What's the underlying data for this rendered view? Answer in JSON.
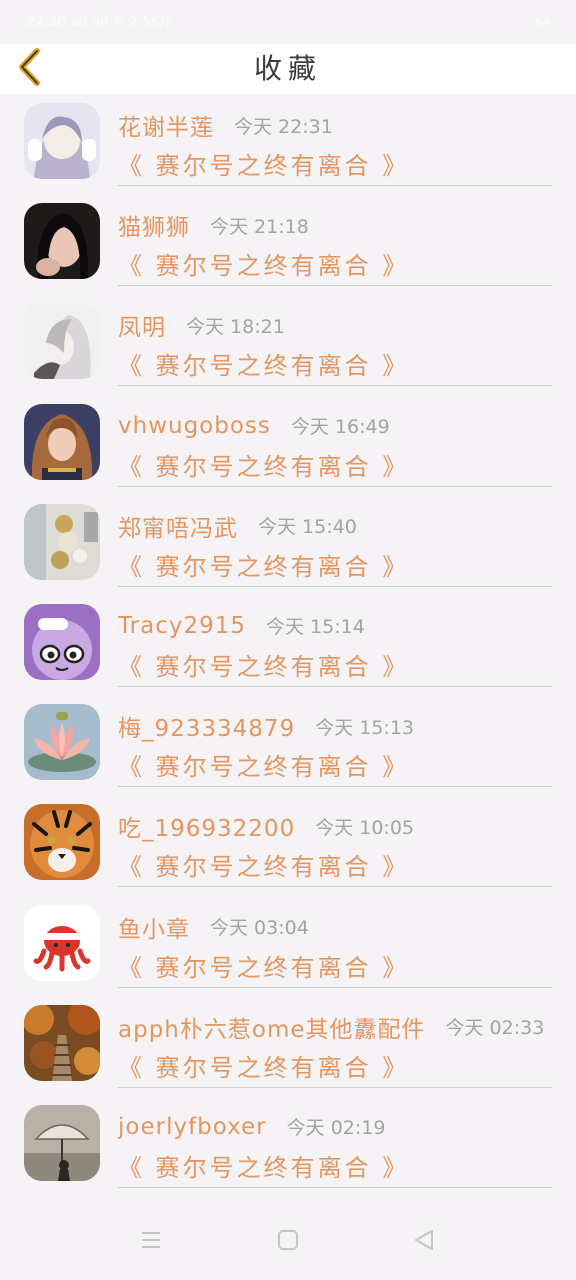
{
  "status_bar": {
    "time_info": "22:30 ail ail ≋ 2.5K/s",
    "battery": "64"
  },
  "header": {
    "title": "收藏",
    "back_icon": "chevron-left-icon",
    "accent_color": "#e0a11c"
  },
  "items": [
    {
      "name": "花谢半莲",
      "time": "今天 22:31",
      "work": "《 赛尔号之终有离合 》"
    },
    {
      "name": "猫狮狮",
      "time": "今天 21:18",
      "work": "《 赛尔号之终有离合 》"
    },
    {
      "name": "凤明",
      "time": "今天 18:21",
      "work": "《 赛尔号之终有离合 》"
    },
    {
      "name": "vhwugoboss",
      "time": "今天 16:49",
      "work": "《 赛尔号之终有离合 》"
    },
    {
      "name": "郑甯唔冯武",
      "time": "今天 15:40",
      "work": "《 赛尔号之终有离合 》"
    },
    {
      "name": "Tracy2915",
      "time": "今天 15:14",
      "work": "《 赛尔号之终有离合 》"
    },
    {
      "name": "梅_923334879",
      "time": "今天 15:13",
      "work": "《 赛尔号之终有离合 》"
    },
    {
      "name": "吃_196932200",
      "time": "今天 10:05",
      "work": "《 赛尔号之终有离合 》"
    },
    {
      "name": "鱼小章",
      "time": "今天 03:04",
      "work": "《 赛尔号之终有离合 》"
    },
    {
      "name": "apph朴六惹ome其他纛配件",
      "time": "今天 02:33",
      "work": "《 赛尔号之终有离合 》"
    },
    {
      "name": "joerlyfboxer",
      "time": "今天 02:19",
      "work": "《 赛尔号之终有离合 》"
    }
  ],
  "nav": {
    "menu_icon": "menu-icon",
    "home_icon": "home-square-icon",
    "back_icon": "back-triangle-icon"
  },
  "colors": {
    "name": "#e39660",
    "time": "#a3a3a3",
    "divider": "#cfcfcf",
    "background": "#f6f3f6"
  }
}
